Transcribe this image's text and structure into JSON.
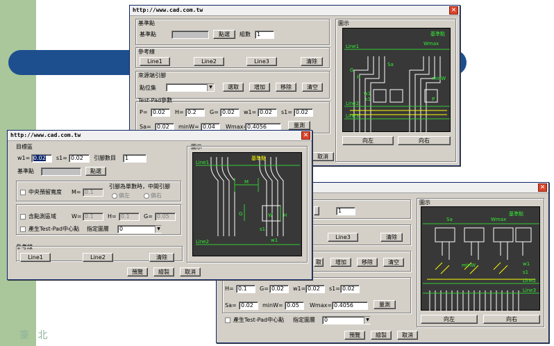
{
  "win1": {
    "title": "http://www.cad.com.tw",
    "close": "✕",
    "base": {
      "group": "基準點",
      "label": "基準點",
      "pick": "點選",
      "count_label": "組數",
      "count": "1"
    },
    "ref": {
      "group": "參考線",
      "line1": "Line1",
      "line2": "Line2",
      "line3": "Line3",
      "clear": "清除"
    },
    "source": {
      "group": "來源端引腳",
      "label": "點位集",
      "select": "選取",
      "add": "增加",
      "remove": "移除",
      "empty": "清空"
    },
    "testpad": {
      "group": "Test-Pad參數",
      "p_label": "P=",
      "p": "0.02",
      "h_label": "H=",
      "h": "0.2",
      "g_label": "G=",
      "g": "0.02",
      "w1_label": "w1=",
      "w1": "0.02",
      "s1_label": "s1=",
      "s1": "0.02",
      "sa_label": "Sa=",
      "sa": "0.02",
      "minw_label": "minW=",
      "minw": "0.04",
      "wmax_label": "Wmax=",
      "wmax": "0.4056",
      "measure": "量測"
    },
    "preview": {
      "group": "圖示",
      "left": "向左",
      "right": "向右"
    },
    "cancel": "取消",
    "diagram": {
      "base": "基準點",
      "wmax": "Wmax",
      "sa": "Sa",
      "minw": "minW",
      "line1": "Line1",
      "line2": "Line2",
      "line3": "Line3",
      "g": "G",
      "h": "H",
      "w1": "w1",
      "s1": "s1",
      "p": "P"
    }
  },
  "win2": {
    "title": "http://www.cad.com.tw",
    "close": "✕",
    "target": {
      "group": "目標區",
      "w1_label": "w1=",
      "w1": "0.02",
      "s1_label": "s1=",
      "s1": "0.02",
      "pins_label": "引腳數目",
      "pins": "1",
      "base_label": "基準點",
      "pick": "點選"
    },
    "center": {
      "label": "中央預留寬度",
      "m_label": "M=",
      "m": "0.1",
      "odd_label": "引腳為單數時，中間引腳",
      "left": "偏左",
      "right": "偏右"
    },
    "pad": {
      "label": "含點測區域",
      "w_label": "W=",
      "w": "0.1",
      "h_label": "H=",
      "h": "0.1",
      "g_label": "G=",
      "g": "0.05",
      "gen_label": "產生Test-Pad中心點",
      "layer_label": "指定圖層",
      "layer": "0"
    },
    "ref": {
      "group": "參考線",
      "line1": "Line1",
      "line2": "Line2",
      "clear": "清除"
    },
    "preview": {
      "group": "圖示"
    },
    "buttons": {
      "preview": "預覽",
      "draw": "繪製",
      "cancel": "取消"
    },
    "diagram": {
      "base": "基準點",
      "line1": "Line1",
      "line2": "Line2",
      "m": "M",
      "g": "G",
      "w": "W",
      "h": "H",
      "s1": "s1",
      "w1": "w1"
    }
  },
  "win3": {
    "close": "✕",
    "count": "1",
    "line3": "Line3",
    "clear": "清除",
    "source": {
      "select": "取",
      "add": "增加",
      "remove": "移除",
      "empty": "清空"
    },
    "params": {
      "h_label": "H=",
      "h": "0.1",
      "g_label": "G=",
      "g": "0.02",
      "w1_label": "w1=",
      "w1": "0.02",
      "s1_label": "s1=",
      "s1": "0.02",
      "sa_label": "Sa=",
      "sa": "0.02",
      "minw_label": "minW=",
      "minw": "0.05",
      "wmax_label": "Wmax=",
      "wmax": "0.4056",
      "measure": "量測"
    },
    "gen_label": "產生Test-Pad中心點",
    "layer_label": "指定圖層",
    "layer": "0",
    "preview": {
      "group": "圖示",
      "left": "向左",
      "right": "向右"
    },
    "buttons": {
      "preview": "預覽",
      "draw": "繪製",
      "cancel": "取消"
    },
    "diagram": {
      "base": "基準點",
      "sa": "Sa",
      "wmax": "Wmax",
      "minw": "minW",
      "w1": "w1",
      "s1": "s1",
      "line2": "Line2",
      "line3": "Line3"
    }
  },
  "slide": {
    "watermark": "豪 北"
  },
  "colors": {
    "accent_bar": "#1d4f8f",
    "strip": "#a9c79b",
    "close": "#d9452a",
    "canvas": "#383838"
  }
}
